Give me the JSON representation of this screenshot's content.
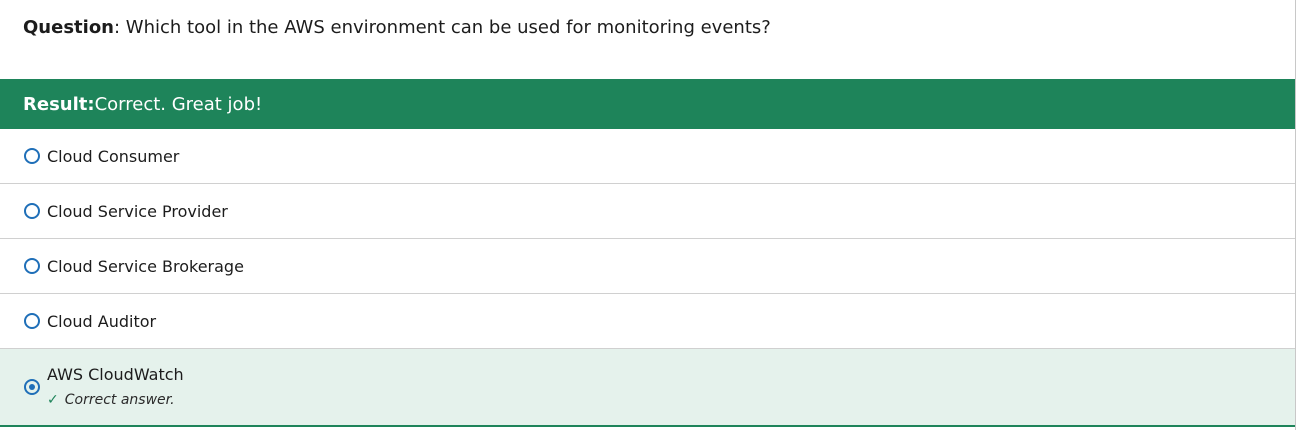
{
  "question": {
    "label": "Question",
    "separator": ":",
    "text": " Which tool in the AWS environment can be used for monitoring events?"
  },
  "result": {
    "label": "Result:",
    "text": " Correct. Great job!",
    "color": "#1e845a"
  },
  "options": [
    {
      "label": "Cloud Consumer"
    },
    {
      "label": "Cloud Service Provider"
    },
    {
      "label": "Cloud Service Brokerage"
    },
    {
      "label": "Cloud Auditor"
    },
    {
      "label": "AWS CloudWatch"
    }
  ],
  "selected_option": {
    "feedback_icon": "checkmark-icon",
    "feedback_text": "Correct answer."
  }
}
